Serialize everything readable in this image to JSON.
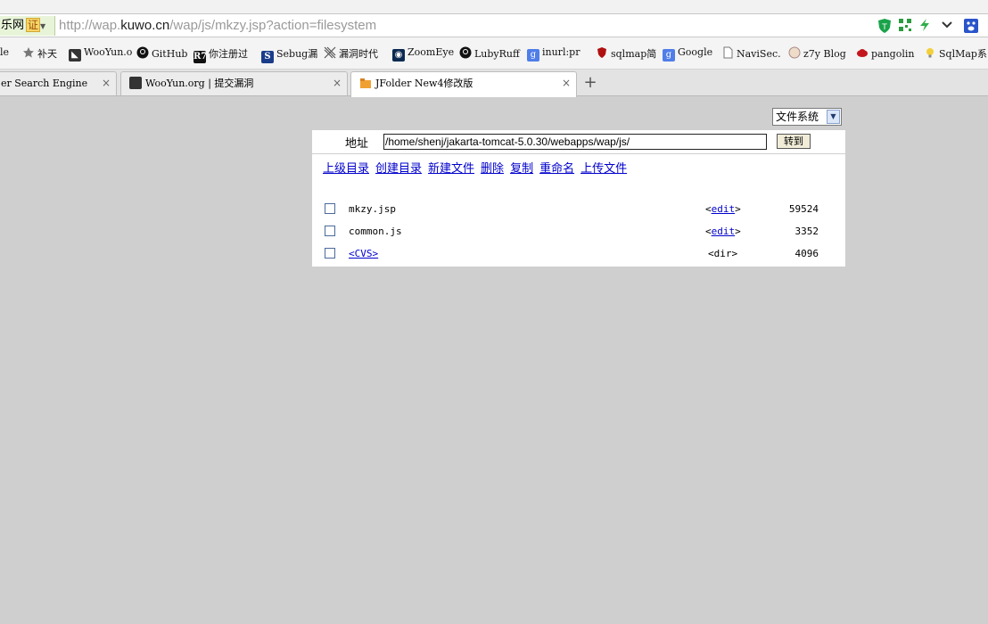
{
  "browser": {
    "security_badge": "乐网",
    "security_badge_cert": "证",
    "url_prefix": "http://wap.",
    "url_host": "kuwo.cn",
    "url_path": "/wap/js/mkzy.jsp?action=filesystem",
    "bookmarks": [
      {
        "label": "le",
        "icon": "bookmark-icon"
      },
      {
        "label": "补天",
        "icon": "star-icon"
      },
      {
        "label": "WooYun.o",
        "icon": "wooyun-icon"
      },
      {
        "label": "GitHub",
        "icon": "github-icon"
      },
      {
        "label": "你注册过",
        "icon": "r7-icon",
        "icon_text": "R7"
      },
      {
        "label": "Sebug漏",
        "icon": "sebug-icon",
        "icon_text": "S"
      },
      {
        "label": "漏洞时代",
        "icon": "crosshatch-icon"
      },
      {
        "label": "ZoomEye",
        "icon": "zoomeye-icon"
      },
      {
        "label": "LubyRuff",
        "icon": "github-icon"
      },
      {
        "label": "inurl:pr",
        "icon": "google-icon",
        "icon_text": "g"
      },
      {
        "label": "sqlmap简",
        "icon": "shield-icon"
      },
      {
        "label": "Google",
        "icon": "google-icon",
        "icon_text": "g"
      },
      {
        "label": "NaviSec.",
        "icon": "page-icon"
      },
      {
        "label": "z7y Blog",
        "icon": "avatar-icon"
      },
      {
        "label": "pangolin",
        "icon": "redhat-icon"
      },
      {
        "label": "SqlMap系",
        "icon": "bulb-icon"
      }
    ],
    "tabs": [
      {
        "label": "er Search Engine",
        "close": "×"
      },
      {
        "label": "WooYun.org | 提交漏洞",
        "close": "×"
      },
      {
        "label": "JFolder New4修改版",
        "close": "×"
      }
    ],
    "new_tab": "+"
  },
  "page": {
    "fs_select_value": "文件系统",
    "address_label": "地址",
    "path_value": "/home/shenj/jakarta-tomcat-5.0.30/webapps/wap/js/",
    "go_button": "转到",
    "actions": [
      "上级目录",
      "创建目录",
      "新建文件",
      "删除",
      "复制",
      "重命名",
      "上传文件"
    ],
    "files": [
      {
        "name": "mkzy.jsp",
        "action_open": "<",
        "action_link": "edit",
        "action_close": ">",
        "size": "59524",
        "is_dir": false
      },
      {
        "name": "common.js",
        "action_open": "<",
        "action_link": "edit",
        "action_close": ">",
        "size": "3352",
        "is_dir": false
      },
      {
        "name": "<CVS>",
        "action_text": "<dir>",
        "size": "4096",
        "is_dir": true
      }
    ]
  }
}
